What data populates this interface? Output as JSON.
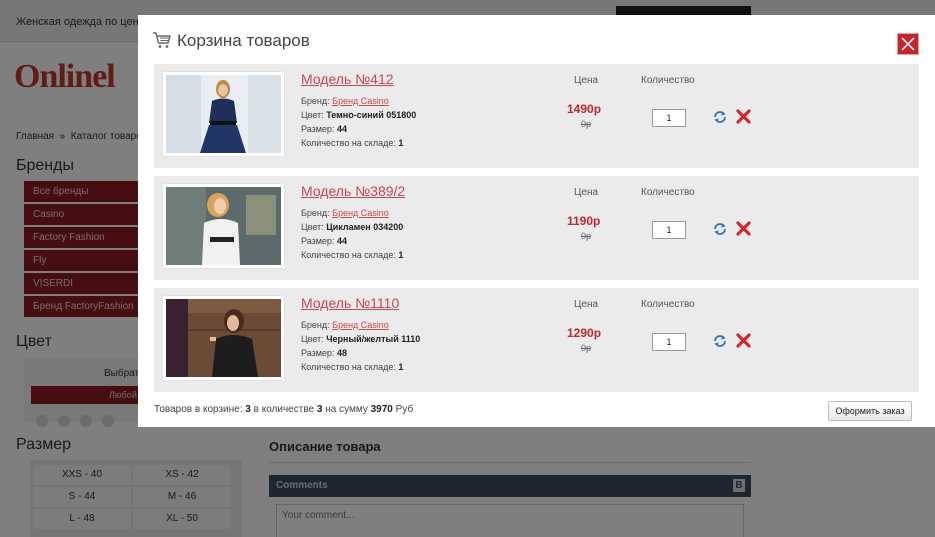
{
  "background": {
    "topbar_text": "Женская одежда по цене",
    "logo_text": "Onlinel",
    "breadcrumb": {
      "home": "Главная",
      "sep": "»",
      "catalog": "Каталог товаро"
    },
    "brands": {
      "title": "Бренды",
      "items": [
        "Все бренды",
        "Casino",
        "Factory Fashion",
        "Fly",
        "VISERDI",
        "Бренд FactoryFashion"
      ]
    },
    "color": {
      "title": "Цвет",
      "choose": "Выбрать",
      "any": "Любой"
    },
    "size": {
      "title": "Размер",
      "items": [
        "XXS - 40",
        "XS - 42",
        "S - 44",
        "M - 46",
        "L - 48",
        "XL - 50"
      ]
    },
    "description_title": "Описание товара",
    "comments": {
      "title": "Comments",
      "badge": "B",
      "placeholder": "Your comment..."
    }
  },
  "modal": {
    "title": "Корзина товаров",
    "columns": {
      "price": "Цена",
      "quantity": "Количество"
    },
    "labels": {
      "brand": "Бренд:",
      "color": "Цвет:",
      "size": "Размер:",
      "stock": "Количество на складе:"
    },
    "items": [
      {
        "name": "Модель №412",
        "brand": "Бренд Casino",
        "color": "Темно-синий 051800",
        "size": "44",
        "stock": "1",
        "price": "1490р",
        "old_price": "0р",
        "qty": "1"
      },
      {
        "name": "Модель №389/2",
        "brand": "Бренд Casino",
        "color": "Цикламен 034200",
        "size": "44",
        "stock": "1",
        "price": "1190р",
        "old_price": "0р",
        "qty": "1"
      },
      {
        "name": "Модель №1110",
        "brand": "Бренд Casino",
        "color": "Черный/желтый 1110",
        "size": "48",
        "stock": "1",
        "price": "1290р",
        "old_price": "0р",
        "qty": "1"
      }
    ],
    "summary": {
      "prefix": "Товаров в корзине:",
      "count": "3",
      "mid": "в количестве",
      "qty": "3",
      "sum_label": "на сумму",
      "sum": "3970",
      "currency": "Руб"
    },
    "checkout_label": "Оформить заказ"
  },
  "colors": {
    "accent": "#c1272d",
    "link": "#c9484f",
    "brand_bg": "#8e1c24",
    "comments_bar": "#3c4f62"
  }
}
